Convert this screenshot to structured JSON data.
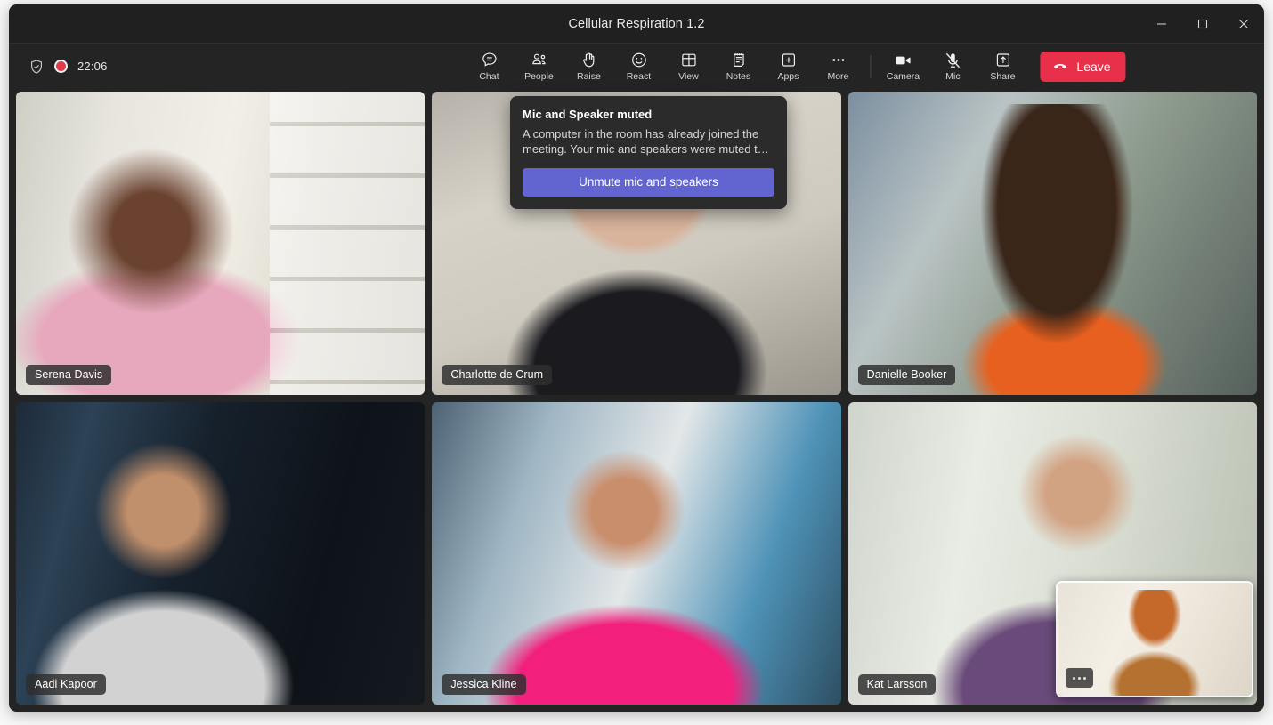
{
  "window": {
    "title": "Cellular Respiration 1.2",
    "controls": [
      {
        "name": "minimize",
        "glyph": "minimize-icon"
      },
      {
        "name": "maximize",
        "glyph": "maximize-icon"
      },
      {
        "name": "close",
        "glyph": "close-icon"
      }
    ]
  },
  "toolbar": {
    "security_icon": "shield-check-icon",
    "recording_icon": "record-dot-icon",
    "elapsed_time": "22:06",
    "items": [
      {
        "label": "Chat",
        "icon": "chat-icon"
      },
      {
        "label": "People",
        "icon": "people-icon"
      },
      {
        "label": "Raise",
        "icon": "raise-hand-icon"
      },
      {
        "label": "React",
        "icon": "react-emoji-icon"
      },
      {
        "label": "View",
        "icon": "view-grid-icon"
      },
      {
        "label": "Notes",
        "icon": "notes-icon"
      },
      {
        "label": "Apps",
        "icon": "apps-plus-icon"
      },
      {
        "label": "More",
        "icon": "more-ellipsis-icon"
      }
    ],
    "device_items": [
      {
        "label": "Camera",
        "icon": "camera-icon",
        "state": "on"
      },
      {
        "label": "Mic",
        "icon": "mic-muted-icon",
        "state": "muted"
      },
      {
        "label": "Share",
        "icon": "share-upload-icon",
        "state": "off"
      }
    ],
    "leave_label": "Leave",
    "leave_icon": "hangup-phone-icon",
    "leave_color": "#e8304a"
  },
  "stage": {
    "tiles": [
      {
        "name": "Serena Davis",
        "video_class": "v-serena"
      },
      {
        "name": "Charlotte de Crum",
        "video_class": "v-charlotte"
      },
      {
        "name": "Danielle Booker",
        "video_class": "v-danielle"
      },
      {
        "name": "Aadi Kapoor",
        "video_class": "v-aadi"
      },
      {
        "name": "Jessica Kline",
        "video_class": "v-jessica"
      },
      {
        "name": "Kat Larsson",
        "video_class": "v-kat"
      }
    ]
  },
  "mute_dialog": {
    "title": "Mic and Speaker muted",
    "body": "A computer in the room has already joined the meeting. Your mic and speakers were muted t…",
    "button_label": "Unmute mic and speakers",
    "button_color": "#6264cf"
  },
  "self_view": {
    "more_icon": "more-ellipsis-icon"
  }
}
